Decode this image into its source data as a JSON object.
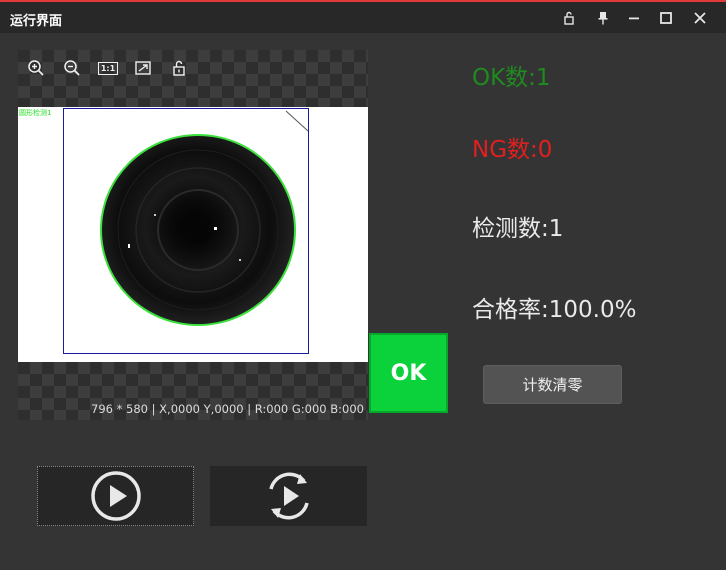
{
  "window": {
    "title": "运行界面"
  },
  "colors": {
    "accent": "#e23a3a",
    "ok": "#0bd23a",
    "ok_text": "#1f8a1f",
    "ng_text": "#e02020",
    "roi_green": "#3ce03c",
    "roi_blue": "#1a1aa0"
  },
  "titlebar_icons": [
    "unlock-icon",
    "pin-icon",
    "minimize-icon",
    "maximize-icon",
    "close-icon"
  ],
  "viewer": {
    "tools": [
      "zoom-in-icon",
      "zoom-out-icon",
      "actual-size-icon",
      "fit-icon",
      "unlock-icon"
    ],
    "actual_size_label": "1:1",
    "roi_label": "圆形检测1",
    "status": "796 * 580  |  X,0000  Y,0000  |  R:000  G:000  B:000"
  },
  "result": {
    "badge": "OK"
  },
  "stats": {
    "ok": "OK数:1",
    "ng": "NG数:0",
    "total": "检测数:1",
    "rate": "合格率:100.0%"
  },
  "buttons": {
    "reset": "计数清零"
  }
}
